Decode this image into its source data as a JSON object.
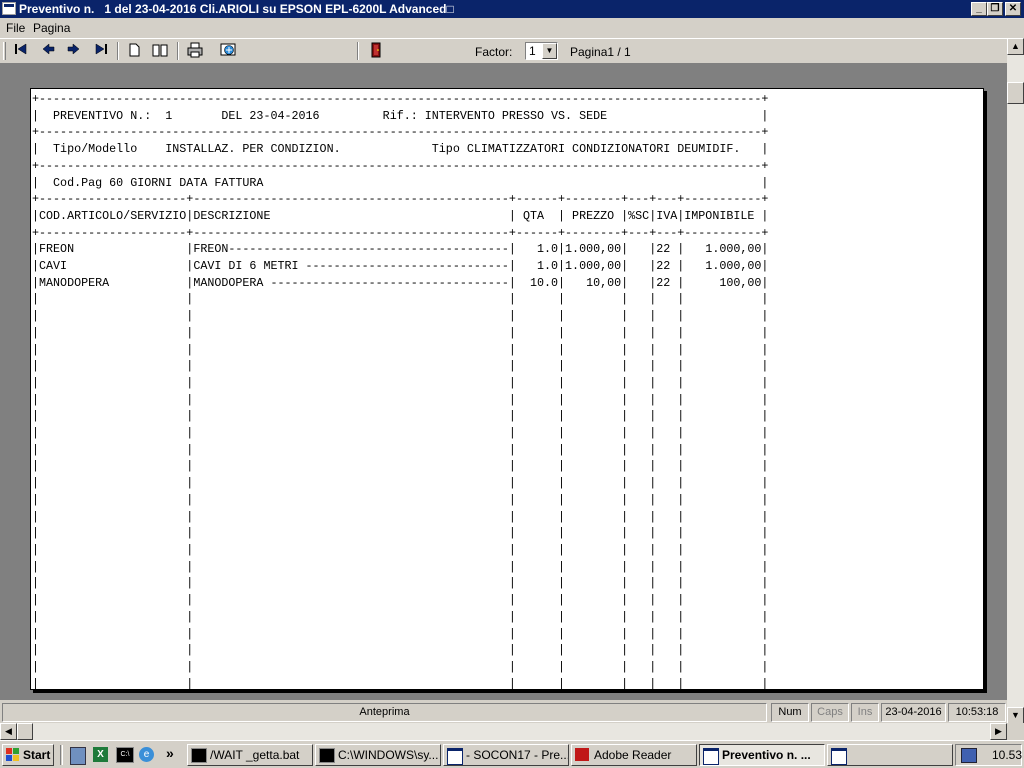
{
  "window": {
    "title": "Preventivo n.   1 del 23-04-2016 Cli.ARIOLI su EPSON EPL-6200L Advanced□",
    "controls": {
      "minimize": "_",
      "restore": "❐",
      "close": "✕"
    }
  },
  "menu": {
    "file": "File",
    "pagina": "Pagina"
  },
  "toolbar": {
    "factor_label": "Factor:",
    "factor_value": "1",
    "page_label": "Pagina1 / 1"
  },
  "document": {
    "header": {
      "preventivo_label": "PREVENTIVO N.:",
      "numero": "1",
      "data": "DEL 23-04-2016",
      "rif": "Rif.: INTERVENTO PRESSO VS. SEDE",
      "tipo_modello_label": "Tipo/Modello",
      "tipo_modello": "INSTALLAZ. PER CONDIZION.",
      "tipo": "Tipo CLIMATIZZATORI CONDIZIONATORI DEUMIDIF.",
      "cod_pag": "Cod.Pag 60 GIORNI DATA FATTURA"
    },
    "columns": [
      "COD.ARTICOLO/SERVIZIO",
      "DESCRIZIONE",
      "QTA",
      "PREZZO",
      "%SC",
      "IVA",
      "IMPONIBILE"
    ],
    "rows": [
      {
        "codice": "FREON",
        "descrizione": "FREON-----------------------------------------",
        "qta": "1.0",
        "prezzo": "1.000,00",
        "sc": "",
        "iva": "22",
        "imponibile": "1.000,00"
      },
      {
        "codice": "CAVI",
        "descrizione": "CAVI DI 6 METRI ------------------------------",
        "qta": "1.0",
        "prezzo": "1.000,00",
        "sc": "",
        "iva": "22",
        "imponibile": "1.000,00"
      },
      {
        "codice": "MANODOPERA",
        "descrizione": "MANODOPERA -----------------------------------",
        "qta": "10.0",
        "prezzo": "10,00",
        "sc": "",
        "iva": "22",
        "imponibile": "100,00"
      }
    ]
  },
  "statusbar": {
    "mode": "Anteprima",
    "num": "Num",
    "caps": "Caps",
    "ins": "Ins",
    "date": "23-04-2016",
    "time": "10:53:18"
  },
  "taskbar": {
    "start": "Start",
    "overflow": "»",
    "tasks": [
      {
        "label": "/WAIT _getta.bat",
        "icon": "console-icon"
      },
      {
        "label": "C:\\WINDOWS\\sy...",
        "icon": "console-icon"
      },
      {
        "label": "- SOCON17 - Pre...",
        "icon": "window-icon"
      },
      {
        "label": "Adobe Reader",
        "icon": "adobe-icon"
      },
      {
        "label": "Preventivo n.   ...",
        "icon": "window-icon"
      },
      {
        "label": "",
        "icon": "window-icon"
      }
    ],
    "clock": "10.53"
  },
  "colors": {
    "titlebar": "#0a246a",
    "chrome": "#d4d0c8",
    "preview_bg": "#808080"
  }
}
